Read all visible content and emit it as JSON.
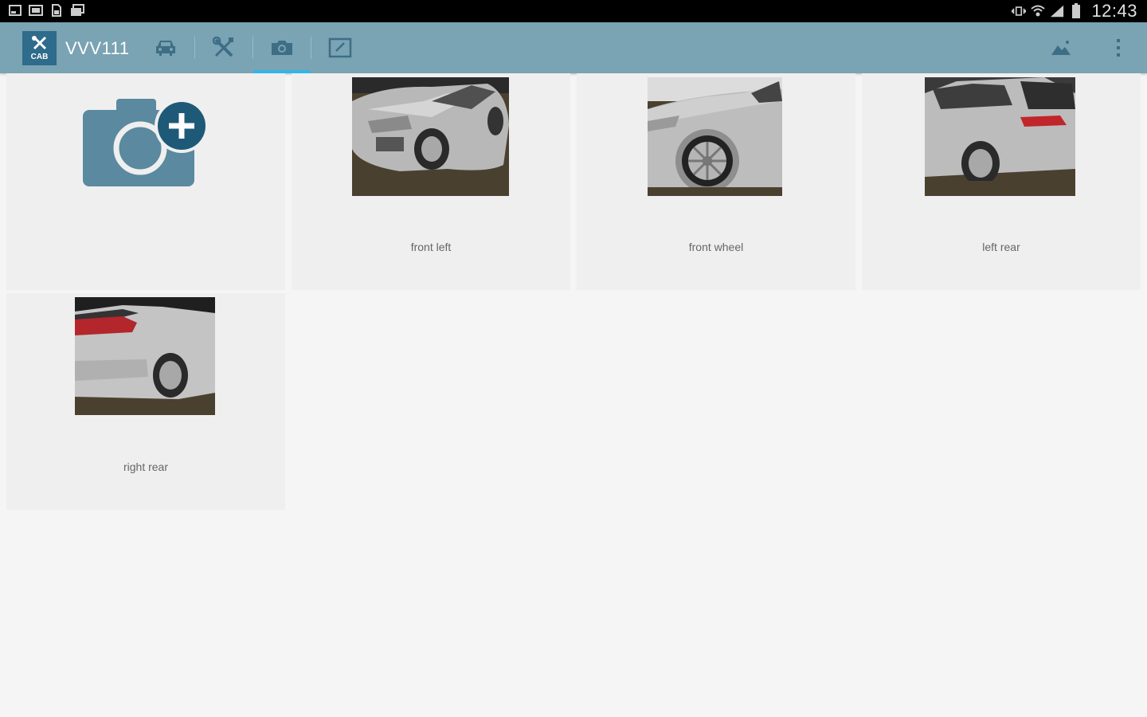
{
  "status_bar": {
    "time": "12:43",
    "left_icons": [
      "screenshot-icon",
      "gallery-icon",
      "document-icon",
      "photos-icon"
    ],
    "right_icons": [
      "vibrate-icon",
      "wifi-icon",
      "signal-icon",
      "battery-icon"
    ]
  },
  "app_bar": {
    "logo_text": "CAB",
    "title": "VVV111",
    "tabs": [
      {
        "icon": "car-icon",
        "active": false
      },
      {
        "icon": "tools-icon",
        "active": false
      },
      {
        "icon": "camera-icon",
        "active": true
      },
      {
        "icon": "edit-icon",
        "active": false
      }
    ],
    "actions": [
      "landscape-icon",
      "overflow-menu-icon"
    ],
    "accent": "#33b5e5",
    "bar_color": "#7aa3b3"
  },
  "photos": {
    "add_button_icon": "add-photo-icon",
    "items": [
      {
        "label": "front left"
      },
      {
        "label": "front wheel"
      },
      {
        "label": "left rear"
      },
      {
        "label": "right rear"
      }
    ]
  }
}
